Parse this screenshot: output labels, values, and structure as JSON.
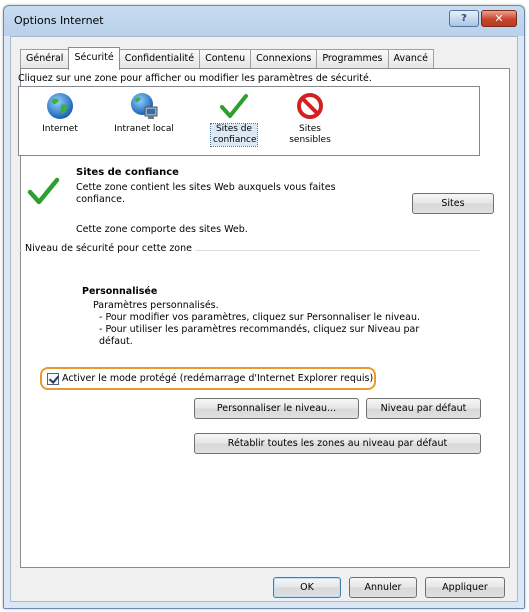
{
  "window": {
    "title": "Options Internet",
    "help_label": "?",
    "close_label": "✕"
  },
  "tabs": [
    {
      "label": "Général"
    },
    {
      "label": "Sécurité"
    },
    {
      "label": "Confidentialité"
    },
    {
      "label": "Contenu"
    },
    {
      "label": "Connexions"
    },
    {
      "label": "Programmes"
    },
    {
      "label": "Avancé"
    }
  ],
  "security": {
    "instruction": "Cliquez sur une zone pour afficher ou modifier les paramètres de sécurité.",
    "zones": [
      {
        "label": "Internet",
        "icon": "globe-icon"
      },
      {
        "label": "Intranet local",
        "icon": "intranet-icon"
      },
      {
        "label": "Sites de confiance",
        "icon": "checkmark-icon"
      },
      {
        "label": "Sites sensibles",
        "icon": "prohibited-icon"
      }
    ],
    "selected_title": "Sites de confiance",
    "selected_desc": "Cette zone contient les sites Web auxquels vous faites confiance.",
    "selected_note": "Cette zone comporte des sites Web.",
    "sites_button": "Sites",
    "level_group_label": "Niveau de sécurité pour cette zone",
    "level_title": "Personnalisée",
    "level_lines": [
      "Paramètres personnalisés.",
      "- Pour modifier vos paramètres, cliquez sur Personnaliser le niveau.",
      "- Pour utiliser les paramètres recommandés, cliquez sur Niveau par",
      "défaut."
    ],
    "protected_mode_label": "Activer le mode protégé (redémarrage d'Internet Explorer requis)",
    "custom_level_button": "Personnaliser le niveau...",
    "default_level_button": "Niveau par défaut",
    "reset_all_button": "Rétablir toutes les zones au niveau par défaut"
  },
  "footer": {
    "ok": "OK",
    "cancel": "Annuler",
    "apply": "Appliquer"
  },
  "colors": {
    "highlight": "#e89a2e",
    "check_green": "#2e9e2e",
    "prohibited_red": "#d42020"
  }
}
